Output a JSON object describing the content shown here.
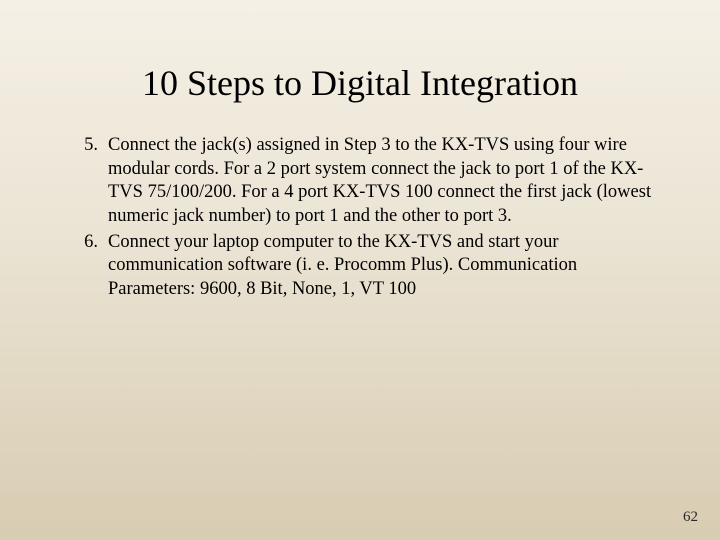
{
  "title": "10 Steps to Digital Integration",
  "items": [
    {
      "num": "5.",
      "text": "Connect the jack(s) assigned in Step 3 to the KX-TVS using four wire modular cords. For a 2 port system connect the jack to port 1 of the KX-TVS 75/100/200. For a 4 port KX-TVS 100 connect the first jack (lowest numeric jack number) to port 1 and the other to port 3."
    },
    {
      "num": "6.",
      "text": "Connect your laptop computer to the KX-TVS and start your communication software (i. e. Procomm Plus). Communication Parameters: 9600, 8 Bit, None, 1, VT 100"
    }
  ],
  "page_number": "62"
}
